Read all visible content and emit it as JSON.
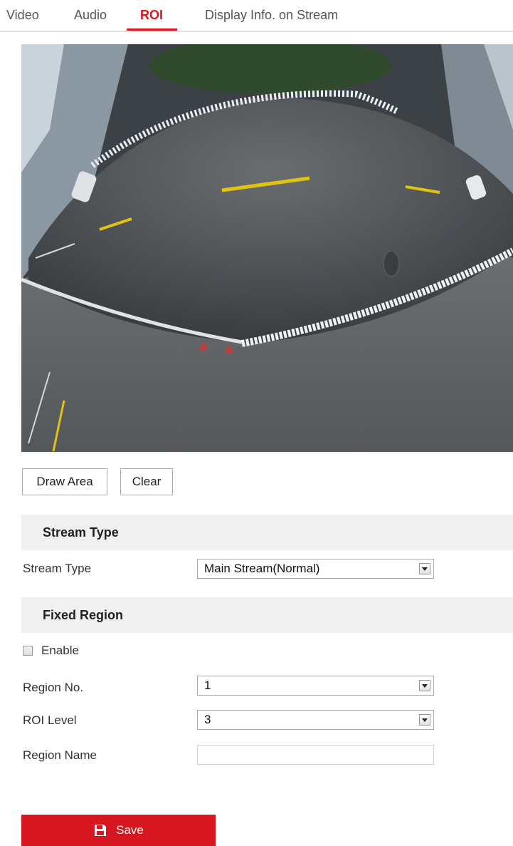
{
  "tabs": [
    {
      "label": "Video",
      "active": false
    },
    {
      "label": "Audio",
      "active": false
    },
    {
      "label": "ROI",
      "active": true
    },
    {
      "label": "Display Info. on Stream",
      "active": false
    }
  ],
  "preview": {
    "description_icon": "fisheye-camera-preview"
  },
  "buttons": {
    "draw_area": "Draw Area",
    "clear": "Clear",
    "save": "Save"
  },
  "stream_section": {
    "title": "Stream Type",
    "stream_type_label": "Stream Type",
    "stream_type_value": "Main Stream(Normal)"
  },
  "fixed_region": {
    "title": "Fixed Region",
    "enable_label": "Enable",
    "enable_checked": false,
    "region_no_label": "Region No.",
    "region_no_value": "1",
    "roi_level_label": "ROI Level",
    "roi_level_value": "3",
    "region_name_label": "Region Name",
    "region_name_value": ""
  },
  "colors": {
    "accent": "#d7171f",
    "section_bg": "#f0f0f0"
  }
}
